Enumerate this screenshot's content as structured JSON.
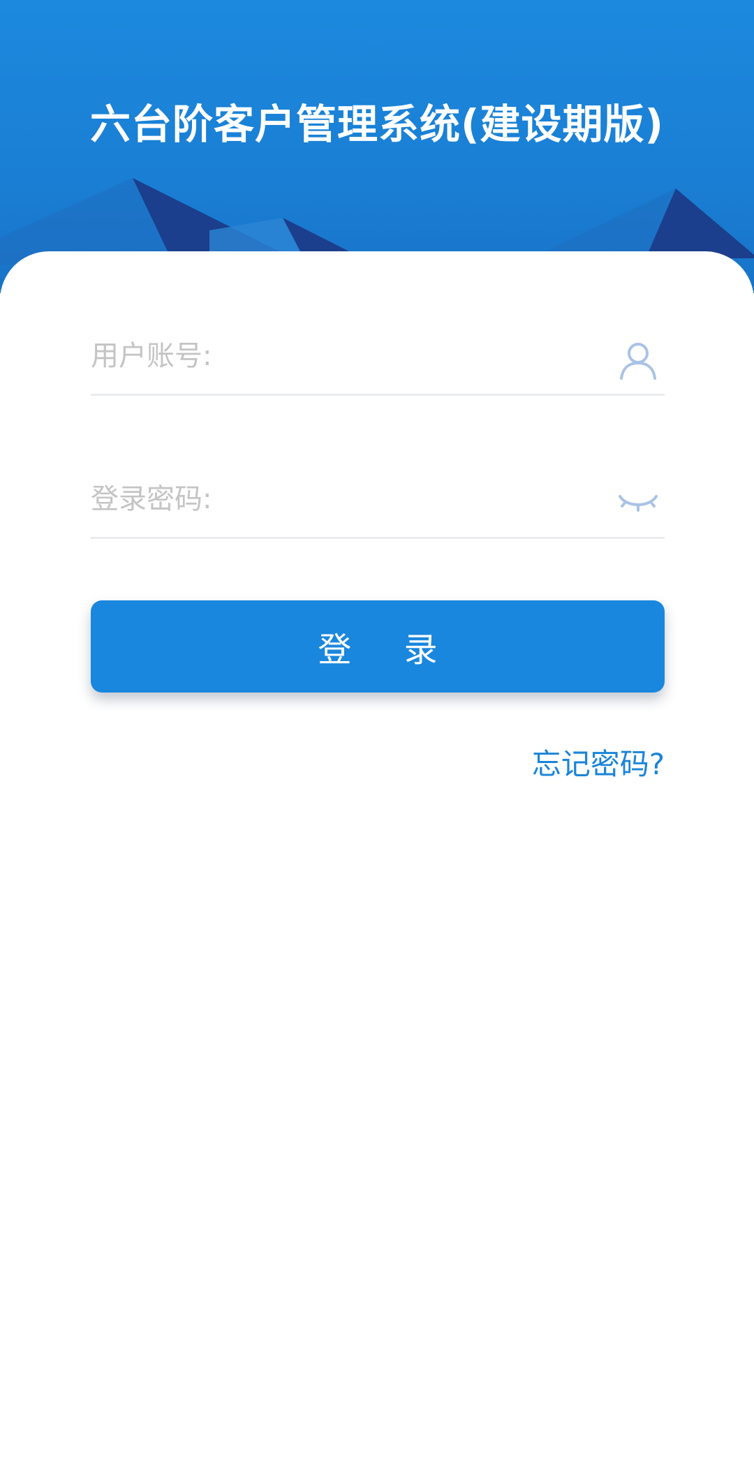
{
  "header": {
    "title": "六台阶客户管理系统(建设期版)"
  },
  "login_form": {
    "username_placeholder": "用户账号:",
    "username_value": "",
    "password_placeholder": "登录密码:",
    "password_value": "",
    "login_label": "登 录",
    "forgot_password_label": "忘记密码?"
  },
  "icons": {
    "username": "user-icon",
    "password": "eye-closed-icon"
  },
  "colors": {
    "header_blue": "#1c89de",
    "mountain_dark": "#1b3f8c",
    "button_blue": "#1a87de",
    "link_blue": "#1a84d8",
    "icon_blue": "#a9c3e6",
    "placeholder_gray": "#c4c4c4"
  }
}
